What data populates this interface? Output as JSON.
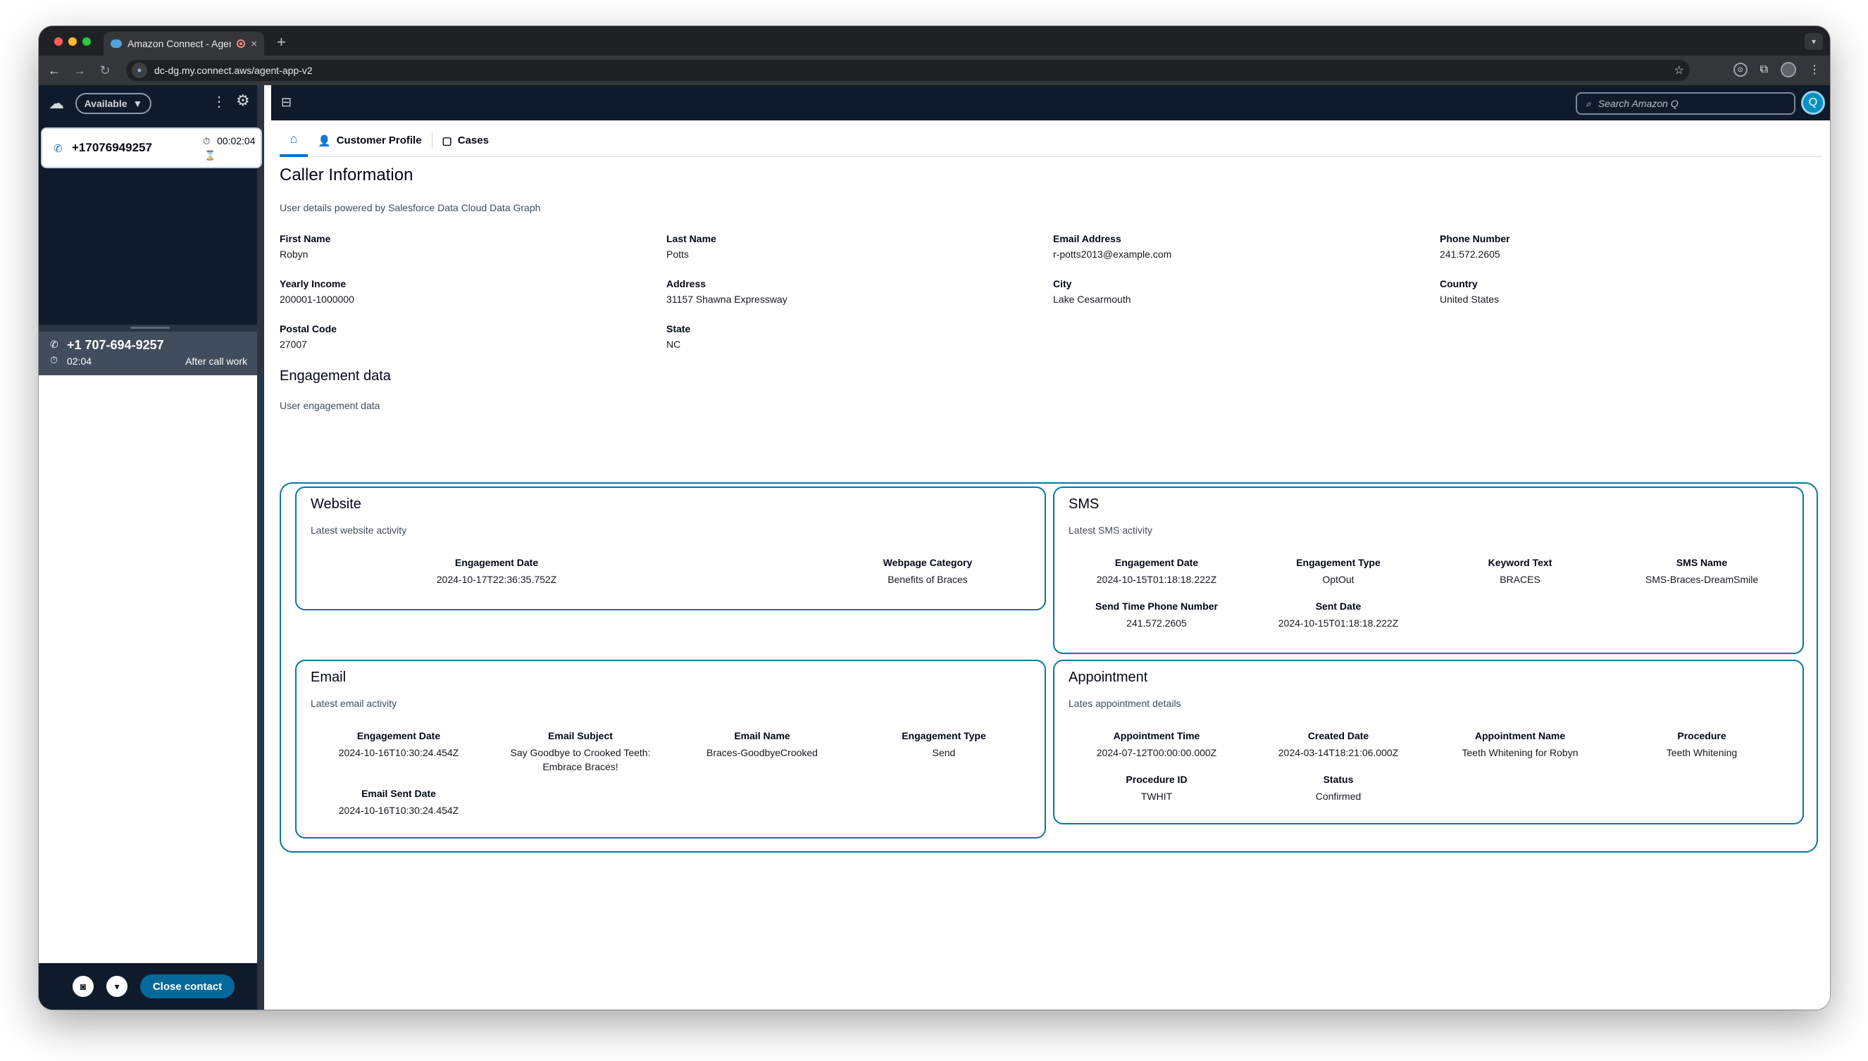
{
  "browser": {
    "tab_title": "Amazon Connect - Agent",
    "tab_close": "×",
    "new_tab": "+",
    "url": "dc-dg.my.connect.aws/agent-app-v2"
  },
  "ccp": {
    "status": "Available",
    "active_contact": {
      "number": "+17076949257",
      "timer": "00:02:04"
    },
    "acw_contact": {
      "number": "+1 707-694-9257",
      "time": "02:04",
      "state": "After call work"
    },
    "close_contact_label": "Close contact"
  },
  "workspace": {
    "search_placeholder": "Search Amazon Q",
    "tabs": [
      "Customer Profile",
      "Cases"
    ]
  },
  "caller": {
    "title": "Caller Information",
    "subtitle": "User details powered by Salesforce Data Cloud Data Graph",
    "fields": [
      {
        "label": "First Name",
        "value": "Robyn"
      },
      {
        "label": "Last Name",
        "value": "Potts"
      },
      {
        "label": "Email Address",
        "value": "r-potts2013@example.com"
      },
      {
        "label": "Phone Number",
        "value": "241.572.2605"
      },
      {
        "label": "Yearly Income",
        "value": "200001-1000000"
      },
      {
        "label": "Address",
        "value": "31157 Shawna Expressway"
      },
      {
        "label": "City",
        "value": "Lake Cesarmouth"
      },
      {
        "label": "Country",
        "value": "United States"
      },
      {
        "label": "Postal Code",
        "value": "27007"
      },
      {
        "label": "State",
        "value": "NC"
      }
    ]
  },
  "engagement": {
    "title": "Engagement data",
    "subtitle": "User engagement data",
    "website": {
      "title": "Website",
      "subtitle": "Latest website activity",
      "fields": [
        {
          "label": "Engagement Date",
          "value": "2024-10-17T22:36:35.752Z"
        },
        {
          "label": "Webpage Category",
          "value": "Benefits of Braces"
        }
      ]
    },
    "sms": {
      "title": "SMS",
      "subtitle": "Latest SMS activity",
      "fields": [
        {
          "label": "Engagement Date",
          "value": "2024-10-15T01:18:18.222Z"
        },
        {
          "label": "Engagement Type",
          "value": "OptOut"
        },
        {
          "label": "Keyword Text",
          "value": "BRACES"
        },
        {
          "label": "SMS Name",
          "value": "SMS-Braces-DreamSmile"
        },
        {
          "label": "Send Time Phone Number",
          "value": "241.572.2605"
        },
        {
          "label": "Sent Date",
          "value": "2024-10-15T01:18:18.222Z"
        }
      ]
    },
    "email": {
      "title": "Email",
      "subtitle": "Latest email activity",
      "fields": [
        {
          "label": "Engagement Date",
          "value": "2024-10-16T10:30:24.454Z"
        },
        {
          "label": "Email Subject",
          "value": "Say Goodbye to Crooked Teeth: Embrace Braces!"
        },
        {
          "label": "Email Name",
          "value": "Braces-GoodbyeCrooked"
        },
        {
          "label": "Engagement Type",
          "value": "Send"
        },
        {
          "label": "Email Sent Date",
          "value": "2024-10-16T10:30:24.454Z"
        }
      ]
    },
    "appointment": {
      "title": "Appointment",
      "subtitle": "Lates appointment details",
      "fields": [
        {
          "label": "Appointment Time",
          "value": "2024-07-12T00:00:00.000Z"
        },
        {
          "label": "Created Date",
          "value": "2024-03-14T18:21:06.000Z"
        },
        {
          "label": "Appointment Name",
          "value": "Teeth Whitening for Robyn"
        },
        {
          "label": "Procedure",
          "value": "Teeth Whitening"
        },
        {
          "label": "Procedure ID",
          "value": "TWHIT"
        },
        {
          "label": "Status",
          "value": "Confirmed"
        }
      ]
    }
  }
}
